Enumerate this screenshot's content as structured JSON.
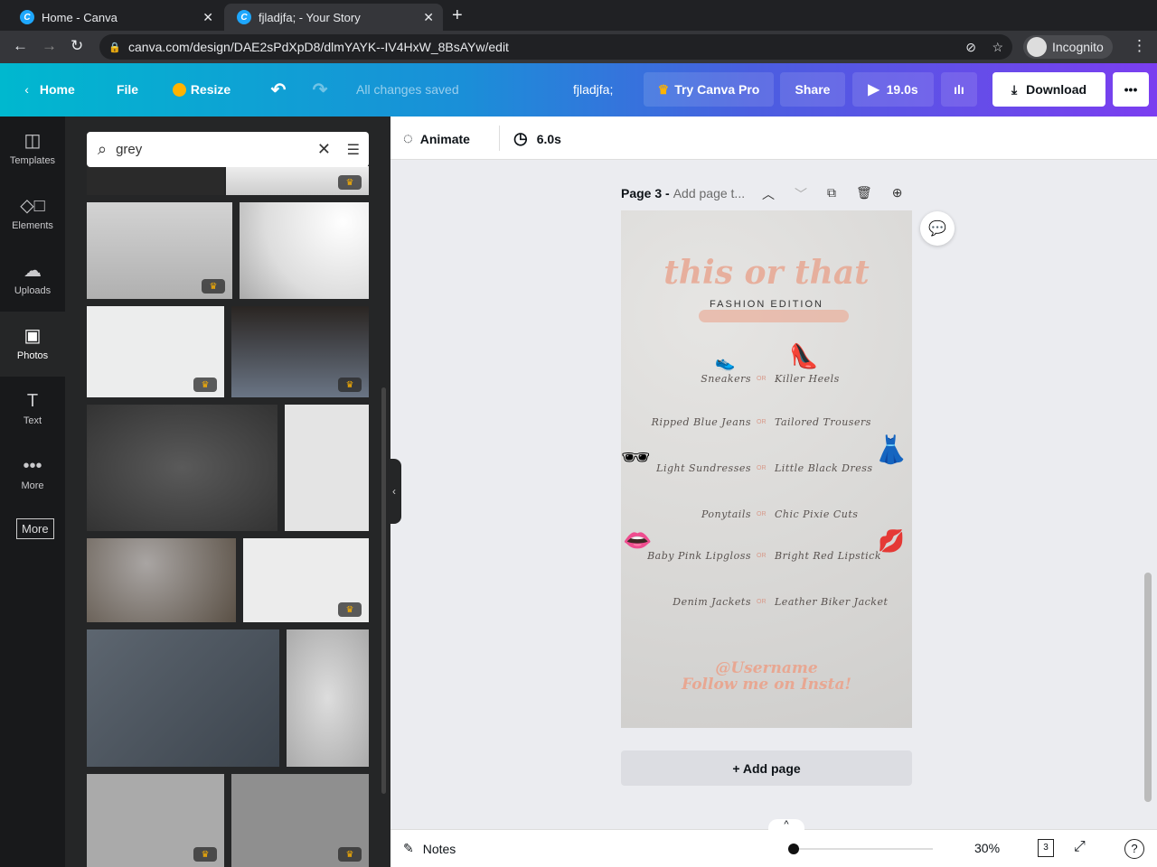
{
  "browser": {
    "tabs": [
      {
        "title": "Home - Canva"
      },
      {
        "title": "fjladjfa; - Your Story"
      }
    ],
    "url": "canva.com/design/DAE2sPdXpD8/dlmYAYK--IV4HxW_8BsAYw/edit",
    "profile": "Incognito"
  },
  "toolbar": {
    "home": "Home",
    "file": "File",
    "resize": "Resize",
    "status": "All changes saved",
    "design_title": "fjladjfa;",
    "try_pro": "Try Canva Pro",
    "share": "Share",
    "duration": "19.0s",
    "download": "Download"
  },
  "rail": {
    "items": [
      {
        "label": "Templates"
      },
      {
        "label": "Elements"
      },
      {
        "label": "Uploads"
      },
      {
        "label": "Photos"
      },
      {
        "label": "Text"
      },
      {
        "label": "More"
      }
    ],
    "tooltip": "More"
  },
  "search": {
    "value": "grey"
  },
  "subbar": {
    "animate": "Animate",
    "duration": "6.0s"
  },
  "page": {
    "label": "Page 3 -",
    "title_placeholder": "Add page t...",
    "add_page": "+ Add page"
  },
  "design": {
    "title": "this or that",
    "subtitle": "FASHION EDITION",
    "or": "OR",
    "pairs": [
      [
        "Sneakers",
        "Killer Heels"
      ],
      [
        "Ripped Blue Jeans",
        "Tailored Trousers"
      ],
      [
        "Light Sundresses",
        "Little Black Dress"
      ],
      [
        "Ponytails",
        "Chic Pixie Cuts"
      ],
      [
        "Baby Pink Lipgloss",
        "Bright Red Lipstick"
      ],
      [
        "Denim Jackets",
        "Leather Biker Jacket"
      ]
    ],
    "footer1": "@Username",
    "footer2": "Follow me on Insta!"
  },
  "bottom": {
    "notes": "Notes",
    "zoom": "30%",
    "zoom_fraction": 0.0,
    "page_count": "3"
  },
  "colors": {
    "accent": "#8b3dff",
    "peach": "#e8a792"
  }
}
